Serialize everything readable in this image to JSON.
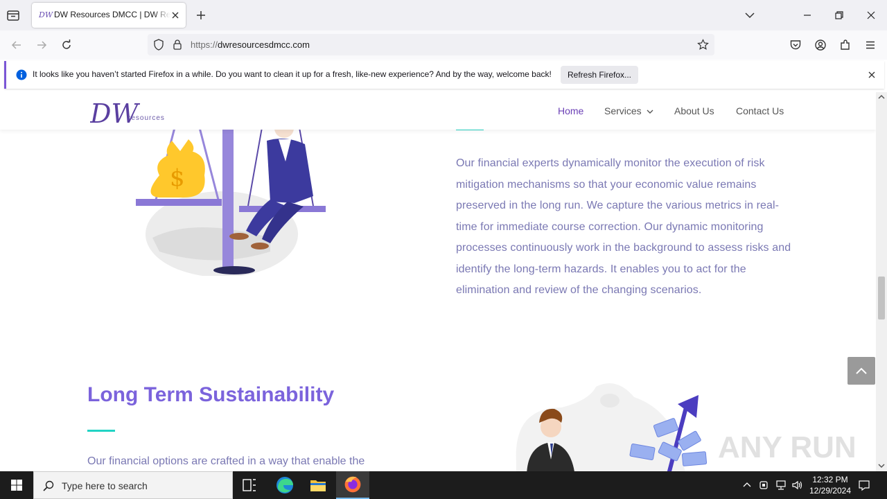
{
  "browser": {
    "tab_title": "DW Resources DMCC | DW Resources",
    "tab_favicon_text": "DW",
    "url_protocol": "https://",
    "url_domain": "dwresourcesdmcc.com"
  },
  "notification": {
    "message": "It looks like you haven’t started Firefox in a while. Do you want to clean it up for a fresh, like-new experience? And by the way, welcome back!",
    "button_label": "Refresh Firefox..."
  },
  "site": {
    "logo_initials": "DW",
    "logo_word": "resources",
    "nav": [
      {
        "label": "Home"
      },
      {
        "label": "Services"
      },
      {
        "label": "About Us"
      },
      {
        "label": "Contact Us"
      }
    ],
    "section1_paragraph": "Our financial experts dynamically monitor the execution of risk mitigation mechanisms so that your economic value remains preserved in the long run. We capture the various metrics in real-time for immediate course correction. Our dynamic monitoring processes continuously work in the background to assess risks and identify the long-term hazards. It enables you to act for the elimination and review of the changing scenarios.",
    "section2_heading": "Long Term Sustainability",
    "section2_paragraph": "Our financial options are crafted in a way that enable the",
    "money_symbol": "$"
  },
  "watermark": {
    "text": "ANY RUN"
  },
  "taskbar": {
    "search_placeholder": "Type here to search",
    "time": "12:32 PM",
    "date": "12/29/2024"
  },
  "colors": {
    "accent_purple": "#7b63dc",
    "accent_teal": "#22d3c4",
    "paragraph": "#7a78b3",
    "nav_active": "#6a3fb5"
  }
}
